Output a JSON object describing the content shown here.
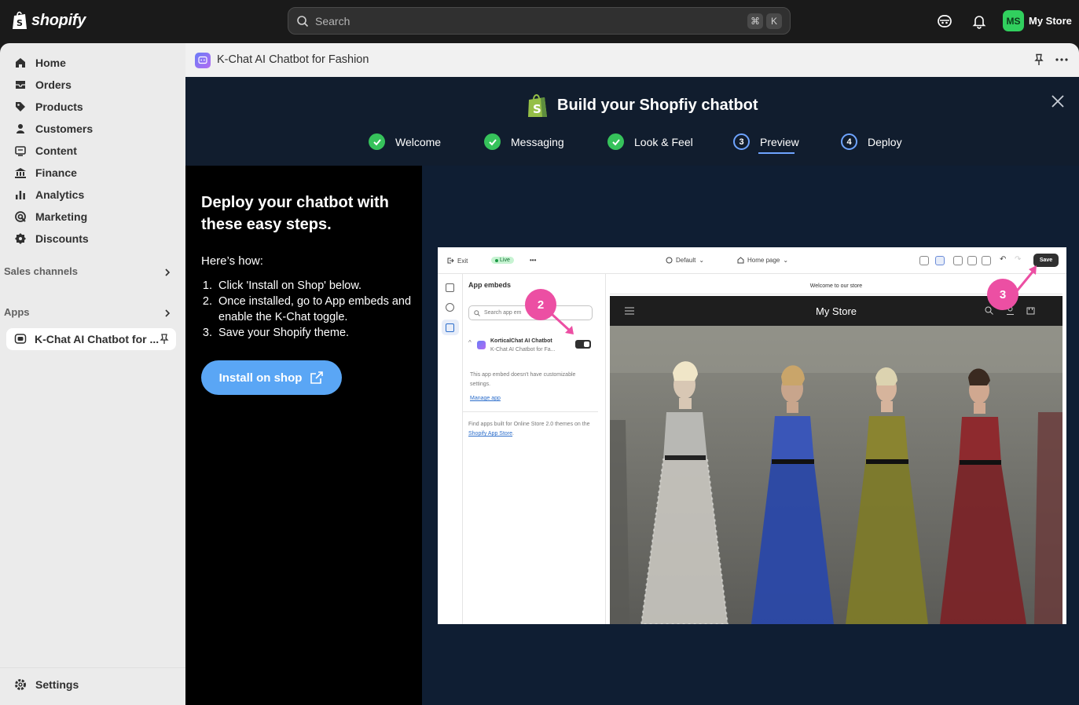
{
  "topbar": {
    "logo_text": "shopify",
    "search_placeholder": "Search",
    "kbd_cmd": "⌘",
    "kbd_key": "K",
    "avatar_initials": "MS",
    "store_name": "My Store"
  },
  "sidebar": {
    "items": [
      {
        "label": "Home",
        "icon": "home-icon"
      },
      {
        "label": "Orders",
        "icon": "orders-icon"
      },
      {
        "label": "Products",
        "icon": "tag-icon"
      },
      {
        "label": "Customers",
        "icon": "person-icon"
      },
      {
        "label": "Content",
        "icon": "content-icon"
      },
      {
        "label": "Finance",
        "icon": "bank-icon"
      },
      {
        "label": "Analytics",
        "icon": "bar-chart-icon"
      },
      {
        "label": "Marketing",
        "icon": "target-icon"
      },
      {
        "label": "Discounts",
        "icon": "discount-icon"
      }
    ],
    "sales_channels_label": "Sales channels",
    "apps_label": "Apps",
    "app_item_label": "K-Chat AI Chatbot for ...",
    "settings_label": "Settings"
  },
  "app_header": {
    "title": "K-Chat AI Chatbot for Fashion"
  },
  "wizard": {
    "title": "Build your Shopfiy chatbot",
    "steps": [
      {
        "label": "Welcome",
        "state": "done"
      },
      {
        "label": "Messaging",
        "state": "done"
      },
      {
        "label": "Look & Feel",
        "state": "done"
      },
      {
        "label": "Preview",
        "state": "current",
        "number": "3"
      },
      {
        "label": "Deploy",
        "state": "todo",
        "number": "4"
      }
    ]
  },
  "left_panel": {
    "heading": "Deploy your chatbot with these easy steps.",
    "how": "Here’s how:",
    "steps": [
      {
        "n": "1.",
        "text": "Click 'Install on Shop' below."
      },
      {
        "n": "2.",
        "text": "Once installed, go to App embeds and enable the K-Chat toggle."
      },
      {
        "n": "3.",
        "text": "Save your Shopify theme."
      }
    ],
    "install_button": "Install on shop"
  },
  "preview": {
    "exit": "Exit",
    "live": "Live",
    "more": "•••",
    "theme": "Default",
    "page": "Home page",
    "save": "Save",
    "panel_title": "App embeds",
    "search_placeholder": "Search app em",
    "app_name": "KorticalChat AI Chatbot",
    "app_sub": "K-Chat AI Chatbot for Fa...",
    "note": "This app embed doesn't have customizable settings.",
    "manage": "Manage app",
    "find_text": "Find apps built for Online Store 2.0 themes on the",
    "find_link": "Shopify App Store",
    "find_end": ".",
    "announcement": "Welcome to our store",
    "store_title": "My Store",
    "badge_2": "2",
    "badge_3": "3"
  },
  "colors": {
    "accent_blue": "#6ea4ff",
    "check_green": "#36c25b",
    "install_button": "#5aa6f5",
    "badge_pink": "#ec4fa3",
    "wizard_bg": "#111d2e",
    "preview_bg": "#0f1e33"
  }
}
